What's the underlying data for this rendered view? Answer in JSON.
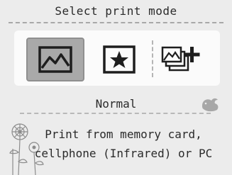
{
  "header": {
    "title": "Select print mode"
  },
  "modes": [
    {
      "id": "normal",
      "icon": "landscape-photo-icon",
      "selected": true
    },
    {
      "id": "favorite",
      "icon": "star-icon",
      "selected": false
    },
    {
      "id": "multi",
      "icon": "add-photos-icon",
      "selected": false
    }
  ],
  "selected_mode": {
    "name": "Normal"
  },
  "description": {
    "line1": "Print from memory card,",
    "line2": "cellphone (Infrared) or PC"
  },
  "colors": {
    "background": "#ececec",
    "panel": "#fbfbfb",
    "selected": "#a9a9a9",
    "text": "#2a2a2a"
  },
  "decorations": {
    "bird": "bird-icon",
    "flowers": "flower-icon"
  }
}
